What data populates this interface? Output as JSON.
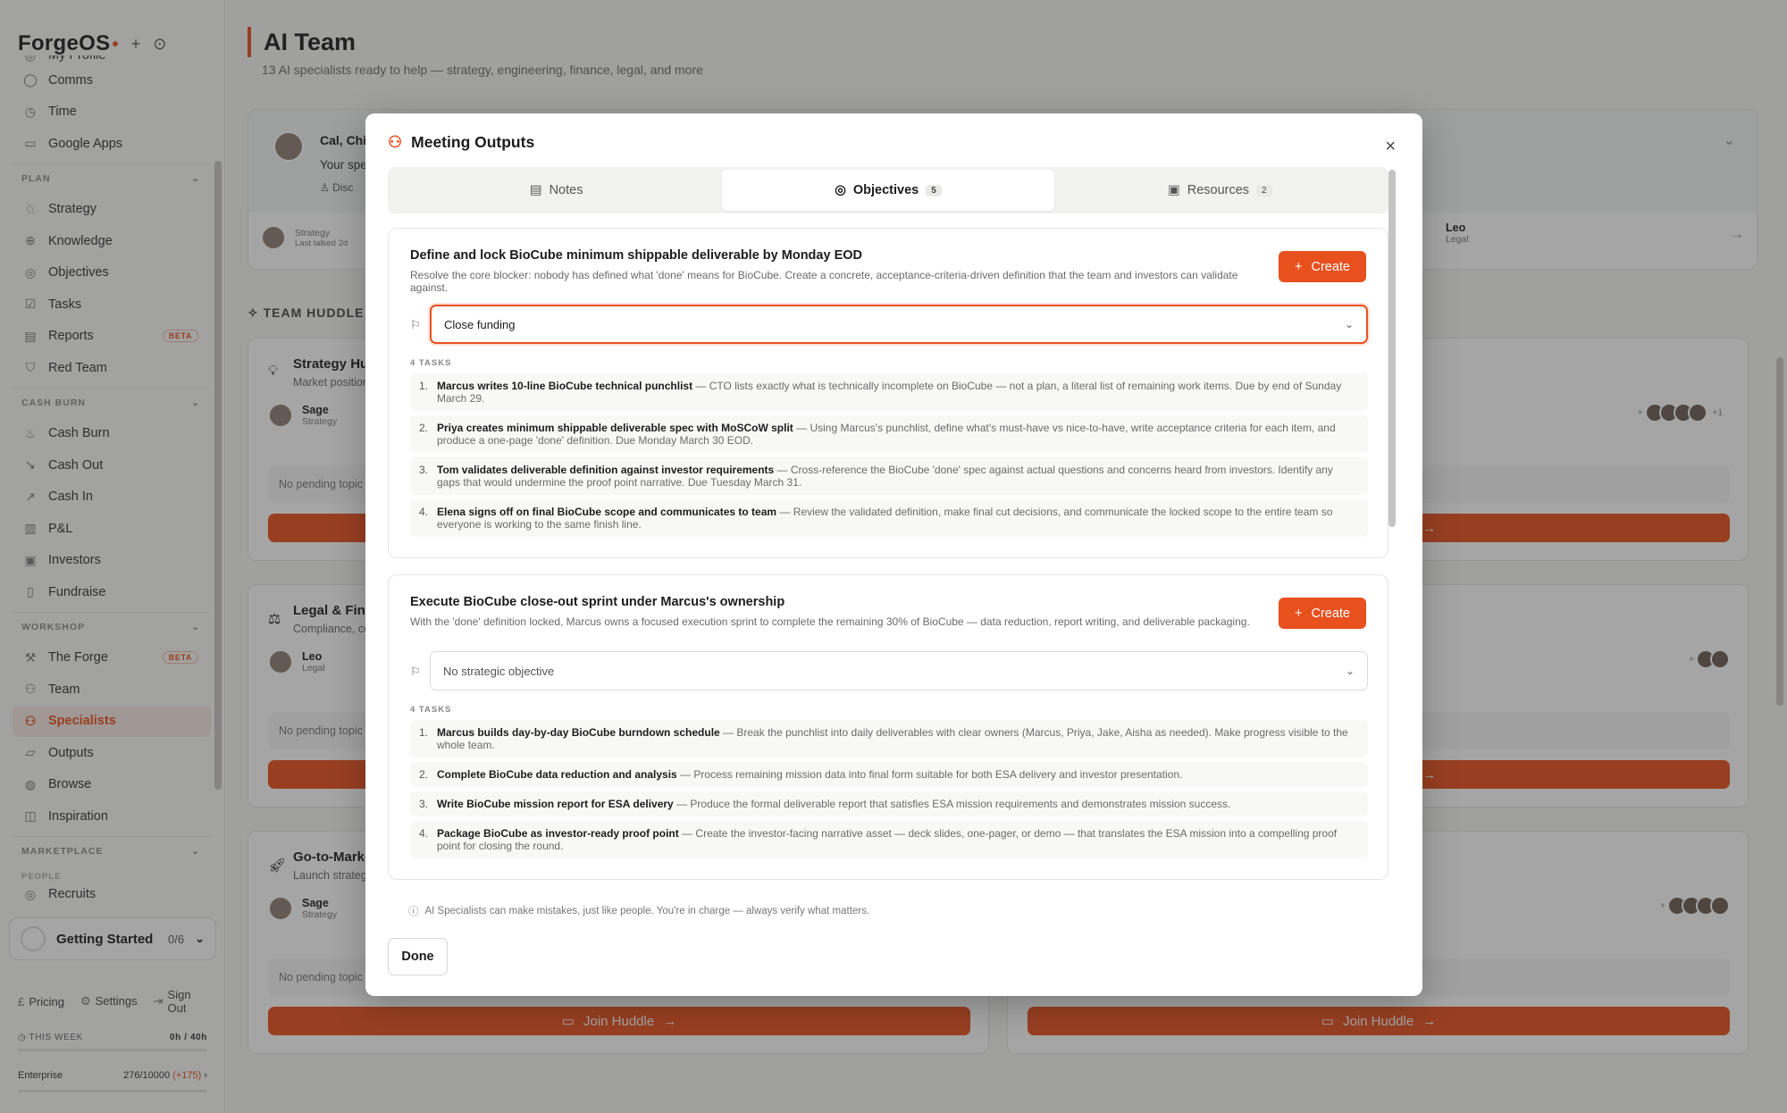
{
  "app": {
    "name": "ForgeOS"
  },
  "sidebar": {
    "partial_top": "My Profile",
    "top_items": [
      {
        "label": "Comms",
        "icon": "chat-icon"
      },
      {
        "label": "Time",
        "icon": "clock-icon"
      },
      {
        "label": "Google Apps",
        "icon": "calendar-icon"
      }
    ],
    "plan": {
      "title": "PLAN",
      "items": [
        {
          "label": "Strategy",
          "icon": "strategy-icon"
        },
        {
          "label": "Knowledge",
          "icon": "globe-icon"
        },
        {
          "label": "Objectives",
          "icon": "target-icon"
        },
        {
          "label": "Tasks",
          "icon": "checkbox-icon"
        },
        {
          "label": "Reports",
          "icon": "document-icon",
          "badge": "BETA"
        },
        {
          "label": "Red Team",
          "icon": "shield-icon"
        }
      ]
    },
    "cashburn": {
      "title": "CASH BURN",
      "items": [
        {
          "label": "Cash Burn",
          "icon": "flame-icon"
        },
        {
          "label": "Cash Out",
          "icon": "trend-down-icon"
        },
        {
          "label": "Cash In",
          "icon": "trend-up-icon"
        },
        {
          "label": "P&L",
          "icon": "chart-icon"
        },
        {
          "label": "Investors",
          "icon": "briefcase-icon"
        },
        {
          "label": "Fundraise",
          "icon": "book-icon"
        }
      ]
    },
    "workshop": {
      "title": "WORKSHOP",
      "items": [
        {
          "label": "The Forge",
          "icon": "hammer-icon",
          "badge": "BETA"
        },
        {
          "label": "Team",
          "icon": "users-icon"
        },
        {
          "label": "Specialists",
          "icon": "specialists-icon",
          "active": true
        },
        {
          "label": "Outputs",
          "icon": "output-icon"
        },
        {
          "label": "Browse",
          "icon": "browse-icon"
        },
        {
          "label": "Inspiration",
          "icon": "lightbulb-icon"
        }
      ]
    },
    "marketplace": {
      "title": "MARKETPLACE",
      "sub": "PEOPLE",
      "partial": "Recruits"
    },
    "getting_started": {
      "label": "Getting Started",
      "count": "0/6"
    },
    "footer": {
      "pricing": "Pricing",
      "settings": "Settings",
      "signout": "Sign Out"
    },
    "week": {
      "label": "THIS WEEK",
      "value": "0h / 40h"
    },
    "plan_tier": {
      "label": "Enterprise",
      "usage": "276/10000",
      "extra": "(+175)"
    }
  },
  "page": {
    "title": "AI Team",
    "subtitle": "13 AI specialists ready to help — strategy, engineering, finance, legal, and more"
  },
  "background": {
    "top_card": {
      "name": "Cal, Chi",
      "text": "Your spe",
      "chip": "Disc"
    },
    "row_left": {
      "name": "Sage",
      "role": "Strategy",
      "meta": "Last talked 2d"
    },
    "row_right": {
      "name": "Leo",
      "role": "Legal"
    },
    "section": "TEAM HUDDLE",
    "huddles": [
      {
        "title": "Strategy Hu",
        "sub": "Market position",
        "person": "Sage",
        "role": "Strategy",
        "pending": "No pending topic",
        "more": "+1"
      },
      {
        "title": "Legal & Fina",
        "sub": "Compliance, co",
        "person": "Leo",
        "role": "Legal",
        "pending": "No pending topic"
      },
      {
        "title": "Go-to-Marke",
        "sub": "Launch strateg",
        "person": "Sage",
        "role": "Strategy",
        "pending": "No pending topic"
      }
    ],
    "join": "Join Huddle"
  },
  "modal": {
    "title": "Meeting Outputs",
    "tabs": [
      {
        "label": "Notes",
        "icon": "notes-icon"
      },
      {
        "label": "Objectives",
        "icon": "target-icon",
        "count": "5"
      },
      {
        "label": "Resources",
        "icon": "box-icon",
        "count": "2"
      }
    ],
    "create_label": "Create",
    "objectives": [
      {
        "title": "Define and lock BioCube minimum shippable deliverable by Monday EOD",
        "desc": "Resolve the core blocker: nobody has defined what 'done' means for BioCube. Create a concrete, acceptance-criteria-driven definition that the team and investors can validate against.",
        "select": "Close funding",
        "tasks_label": "4 TASKS",
        "tasks": [
          {
            "title": "Marcus writes 10-line BioCube technical punchlist",
            "desc": " — CTO lists exactly what is technically incomplete on BioCube — not a plan, a literal list of remaining work items. Due by end of Sunday March 29."
          },
          {
            "title": "Priya creates minimum shippable deliverable spec with MoSCoW split",
            "desc": " — Using Marcus's punchlist, define what's must-have vs nice-to-have, write acceptance criteria for each item, and produce a one-page 'done' definition. Due Monday March 30 EOD."
          },
          {
            "title": "Tom validates deliverable definition against investor requirements",
            "desc": " — Cross-reference the BioCube 'done' spec against actual questions and concerns heard from investors. Identify any gaps that would undermine the proof point narrative. Due Tuesday March 31."
          },
          {
            "title": "Elena signs off on final BioCube scope and communicates to team",
            "desc": " — Review the validated definition, make final cut decisions, and communicate the locked scope to the entire team so everyone is working to the same finish line."
          }
        ]
      },
      {
        "title": "Execute BioCube close-out sprint under Marcus's ownership",
        "desc": "With the 'done' definition locked, Marcus owns a focused execution sprint to complete the remaining 30% of BioCube — data reduction, report writing, and deliverable packaging.",
        "select": "No strategic objective",
        "tasks_label": "4 TASKS",
        "tasks": [
          {
            "title": "Marcus builds day-by-day BioCube burndown schedule",
            "desc": " — Break the punchlist into daily deliverables with clear owners (Marcus, Priya, Jake, Aisha as needed). Make progress visible to the whole team."
          },
          {
            "title": "Complete BioCube data reduction and analysis",
            "desc": " — Process remaining mission data into final form suitable for both ESA delivery and investor presentation."
          },
          {
            "title": "Write BioCube mission report for ESA delivery",
            "desc": " — Produce the formal deliverable report that satisfies ESA mission requirements and demonstrates mission success."
          },
          {
            "title": "Package BioCube as investor-ready proof point",
            "desc": " — Create the investor-facing narrative asset — deck slides, one-pager, or demo — that translates the ESA mission into a compelling proof point for closing the round."
          }
        ]
      }
    ],
    "disclaimer": "AI Specialists can make mistakes, just like people. You're in charge — always verify what matters.",
    "done": "Done"
  }
}
